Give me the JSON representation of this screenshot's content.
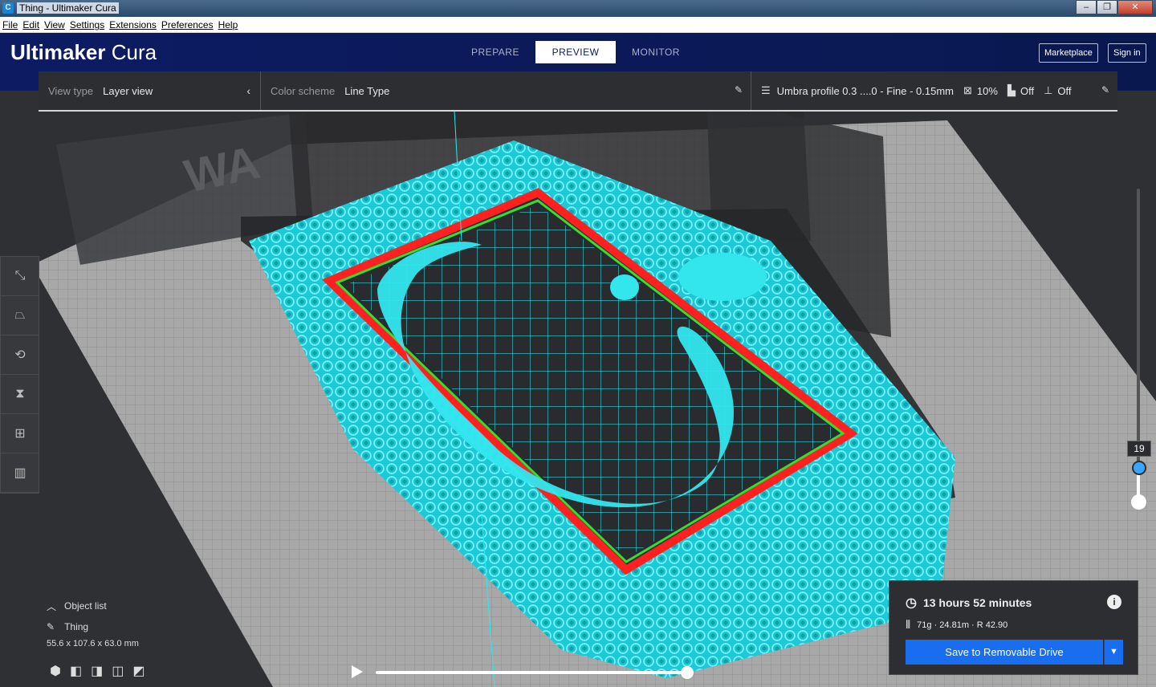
{
  "window": {
    "title": "Thing - Ultimaker Cura",
    "app_icon": "C"
  },
  "menu": [
    "File",
    "Edit",
    "View",
    "Settings",
    "Extensions",
    "Preferences",
    "Help"
  ],
  "header": {
    "brand_bold": "Ultimaker",
    "brand_light": "Cura",
    "tabs": [
      "PREPARE",
      "PREVIEW",
      "MONITOR"
    ],
    "active_tab": "PREVIEW",
    "marketplace": "Marketplace",
    "sign_in": "Sign in"
  },
  "toolbar": {
    "view_type_label": "View type",
    "view_type_value": "Layer view",
    "color_scheme_label": "Color scheme",
    "color_scheme_value": "Line Type",
    "profile": "Umbra profile 0.3 ....0 - Fine - 0.15mm",
    "infill": "10%",
    "support": "Off",
    "adhesion": "Off"
  },
  "layer": {
    "current": "19"
  },
  "objects": {
    "header": "Object list",
    "name": "Thing",
    "dims": "55.6 x 107.6 x 63.0 mm"
  },
  "print_info": {
    "time": "13 hours 52 minutes",
    "material": "71g · 24.81m · R 42.90",
    "save_label": "Save to Removable Drive"
  },
  "colors": {
    "header_bg": "#0b1a5a",
    "accent_blue": "#196ef0",
    "infill_cyan": "#2ce8f0",
    "wall_red": "#ff2020",
    "wall_green": "#33dd33"
  }
}
